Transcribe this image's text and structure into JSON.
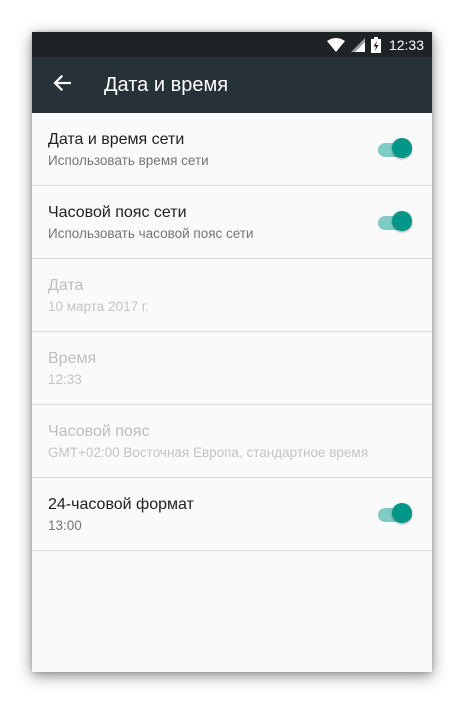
{
  "status_bar": {
    "time": "12:33",
    "icons": [
      "wifi-icon",
      "cell-signal-icon",
      "battery-charging-icon"
    ]
  },
  "app_bar": {
    "back_icon": "arrow-back-icon",
    "title": "Дата и время"
  },
  "settings": [
    {
      "title": "Дата и время сети",
      "summary": "Использовать время сети",
      "enabled": true,
      "toggle": true,
      "checked": true
    },
    {
      "title": "Часовой пояс сети",
      "summary": "Использовать часовой пояс сети",
      "enabled": true,
      "toggle": true,
      "checked": true
    },
    {
      "title": "Дата",
      "summary": "10 марта 2017 г.",
      "enabled": false,
      "toggle": false
    },
    {
      "title": "Время",
      "summary": "12:33",
      "enabled": false,
      "toggle": false
    },
    {
      "title": "Часовой пояс",
      "summary": "GMT+02:00 Восточная Европа, стандартное время",
      "enabled": false,
      "toggle": false
    },
    {
      "title": "24-часовой формат",
      "summary": "13:00",
      "enabled": true,
      "toggle": true,
      "checked": true
    }
  ],
  "colors": {
    "status_bar": "#1e2326",
    "app_bar": "#263238",
    "accent": "#009688",
    "switch_track": "#80cbc4",
    "background": "#fafafa"
  }
}
